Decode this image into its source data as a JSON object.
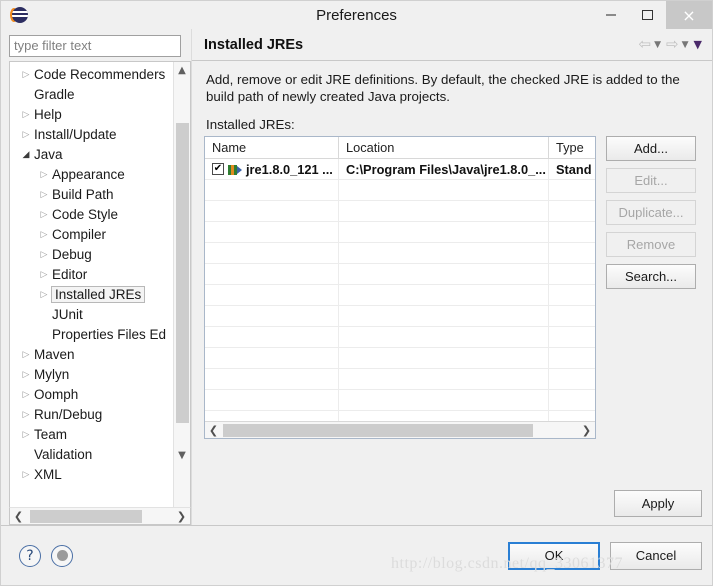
{
  "window": {
    "title": "Preferences",
    "app_icon": "eclipse-icon",
    "controls": {
      "minimize": "–",
      "maximize": "□",
      "close": "×"
    }
  },
  "sidebar": {
    "filter": {
      "placeholder": "type filter text",
      "value": ""
    },
    "items": [
      {
        "label": "Code Recommenders",
        "level": 1,
        "twisty": "collapsed",
        "selected": false
      },
      {
        "label": "Gradle",
        "level": 1,
        "twisty": "none",
        "selected": false
      },
      {
        "label": "Help",
        "level": 1,
        "twisty": "collapsed",
        "selected": false
      },
      {
        "label": "Install/Update",
        "level": 1,
        "twisty": "collapsed",
        "selected": false
      },
      {
        "label": "Java",
        "level": 1,
        "twisty": "expanded",
        "selected": false
      },
      {
        "label": "Appearance",
        "level": 2,
        "twisty": "collapsed",
        "selected": false
      },
      {
        "label": "Build Path",
        "level": 2,
        "twisty": "collapsed",
        "selected": false
      },
      {
        "label": "Code Style",
        "level": 2,
        "twisty": "collapsed",
        "selected": false
      },
      {
        "label": "Compiler",
        "level": 2,
        "twisty": "collapsed",
        "selected": false
      },
      {
        "label": "Debug",
        "level": 2,
        "twisty": "collapsed",
        "selected": false
      },
      {
        "label": "Editor",
        "level": 2,
        "twisty": "collapsed",
        "selected": false
      },
      {
        "label": "Installed JREs",
        "level": 2,
        "twisty": "collapsed",
        "selected": true
      },
      {
        "label": "JUnit",
        "level": 2,
        "twisty": "none",
        "selected": false
      },
      {
        "label": "Properties Files Ed",
        "level": 2,
        "twisty": "none",
        "selected": false
      },
      {
        "label": "Maven",
        "level": 1,
        "twisty": "collapsed",
        "selected": false
      },
      {
        "label": "Mylyn",
        "level": 1,
        "twisty": "collapsed",
        "selected": false
      },
      {
        "label": "Oomph",
        "level": 1,
        "twisty": "collapsed",
        "selected": false
      },
      {
        "label": "Run/Debug",
        "level": 1,
        "twisty": "collapsed",
        "selected": false
      },
      {
        "label": "Team",
        "level": 1,
        "twisty": "collapsed",
        "selected": false
      },
      {
        "label": "Validation",
        "level": 1,
        "twisty": "none",
        "selected": false
      },
      {
        "label": "XML",
        "level": 1,
        "twisty": "collapsed",
        "selected": false
      }
    ]
  },
  "page": {
    "title": "Installed JREs",
    "nav": {
      "back": "⇦",
      "back_caret": "▼",
      "forward": "⇨",
      "forward_caret": "▼",
      "menu_caret": "▼"
    },
    "description": "Add, remove or edit JRE definitions. By default, the checked JRE is added to the build path of newly created Java projects.",
    "list_label": "Installed JREs:"
  },
  "table": {
    "columns": [
      "Name",
      "Location",
      "Type"
    ],
    "rows": [
      {
        "checked": true,
        "check_glyph": "✔",
        "name": "jre1.8.0_121 ...",
        "location": "C:\\Program Files\\Java\\jre1.8.0_...",
        "type": "Stand"
      }
    ],
    "empty_row_count": 12
  },
  "side_buttons": [
    {
      "label": "Add...",
      "enabled": true
    },
    {
      "label": "Edit...",
      "enabled": false
    },
    {
      "label": "Duplicate...",
      "enabled": false
    },
    {
      "label": "Remove",
      "enabled": false
    },
    {
      "label": "Search...",
      "enabled": true
    }
  ],
  "apply_button": {
    "label": "Apply"
  },
  "footer": {
    "help_icon": "?",
    "status_icon": "restore-defaults-icon",
    "ok": "OK",
    "cancel": "Cancel"
  },
  "watermark": "http://blog.csdn.net/qq_33061377",
  "colors": {
    "dialog_bg": "#f0f0f0",
    "table_bg": "#ffffff",
    "focus_blue": "#2a7fd4",
    "close_btn_bg": "#c8c8c8",
    "scrollbar_thumb": "#cdcdcd"
  }
}
